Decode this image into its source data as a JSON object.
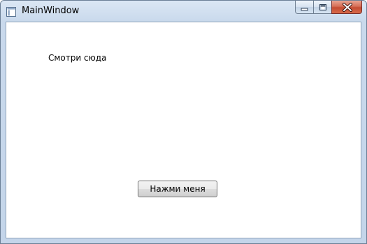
{
  "window": {
    "title": "MainWindow",
    "icon": "window-icon",
    "controls": {
      "minimize_icon": "minimize-icon",
      "maximize_icon": "maximize-icon",
      "close_icon": "close-icon"
    }
  },
  "content": {
    "label_text": "Смотри сюда",
    "button_label": "Нажми меня"
  },
  "colors": {
    "frame": "#c4d5ea",
    "close_button": "#c44c32",
    "client_background": "#ffffff"
  }
}
